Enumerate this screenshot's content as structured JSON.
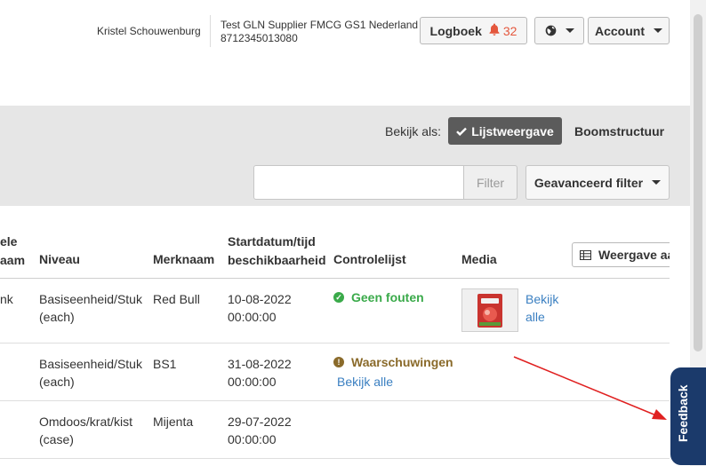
{
  "header": {
    "user_name": "Kristel Schouwenburg",
    "org_name": "Test GLN Supplier FMCG GS1 Nederland",
    "org_gln": "8712345013080",
    "logbook_label": "Logboek",
    "logbook_count": "32",
    "account_label": "Account"
  },
  "view": {
    "label": "Bekijk als:",
    "list_label": "Lijstweergave",
    "tree_label": "Boomstructuur"
  },
  "filter": {
    "placeholder": "",
    "button_label": "Filter",
    "advanced_label": "Geavanceerd filter"
  },
  "table": {
    "headers": {
      "col_partial_1": "ele",
      "col_partial_2": "aam",
      "niveau": "Niveau",
      "merknaam": "Merknaam",
      "start_1": "Startdatum/tijd",
      "start_2": "beschikbaarheid",
      "controlelijst": "Controlelijst",
      "media": "Media"
    },
    "columns_button": "Weergave aa",
    "rows": [
      {
        "partial": "nk",
        "niveau_1": "Basiseenheid/Stuk",
        "niveau_2": "(each)",
        "merknaam": "Red Bull",
        "date": "10-08-2022",
        "time": "00:00:00",
        "check_status": "Geen fouten",
        "media_link_1": "Bekijk",
        "media_link_2": "alle"
      },
      {
        "partial": "",
        "niveau_1": "Basiseenheid/Stuk",
        "niveau_2": "(each)",
        "merknaam": "BS1",
        "date": "31-08-2022",
        "time": "00:00:00",
        "check_status": "Waarschuwingen",
        "check_link": "Bekijk alle"
      },
      {
        "partial": "",
        "niveau_1": "Omdoos/krat/kist",
        "niveau_2": "(case)",
        "merknaam": "Mijenta",
        "date": "29-07-2022",
        "time": "00:00:00"
      }
    ]
  },
  "feedback_label": "Feedback",
  "colors": {
    "accent_dark": "#5b5b5b",
    "ok": "#3aaa4a",
    "warning": "#8a6a2a",
    "link": "#3a7fc1",
    "alert": "#e4573d",
    "feedback_bg": "#1b3a6b",
    "annotation_arrow": "#e02020"
  },
  "icons": [
    "bell-icon",
    "globe-icon",
    "check-icon",
    "table-icon",
    "check-circle-icon",
    "warning-circle-icon",
    "caret-down-icon"
  ]
}
